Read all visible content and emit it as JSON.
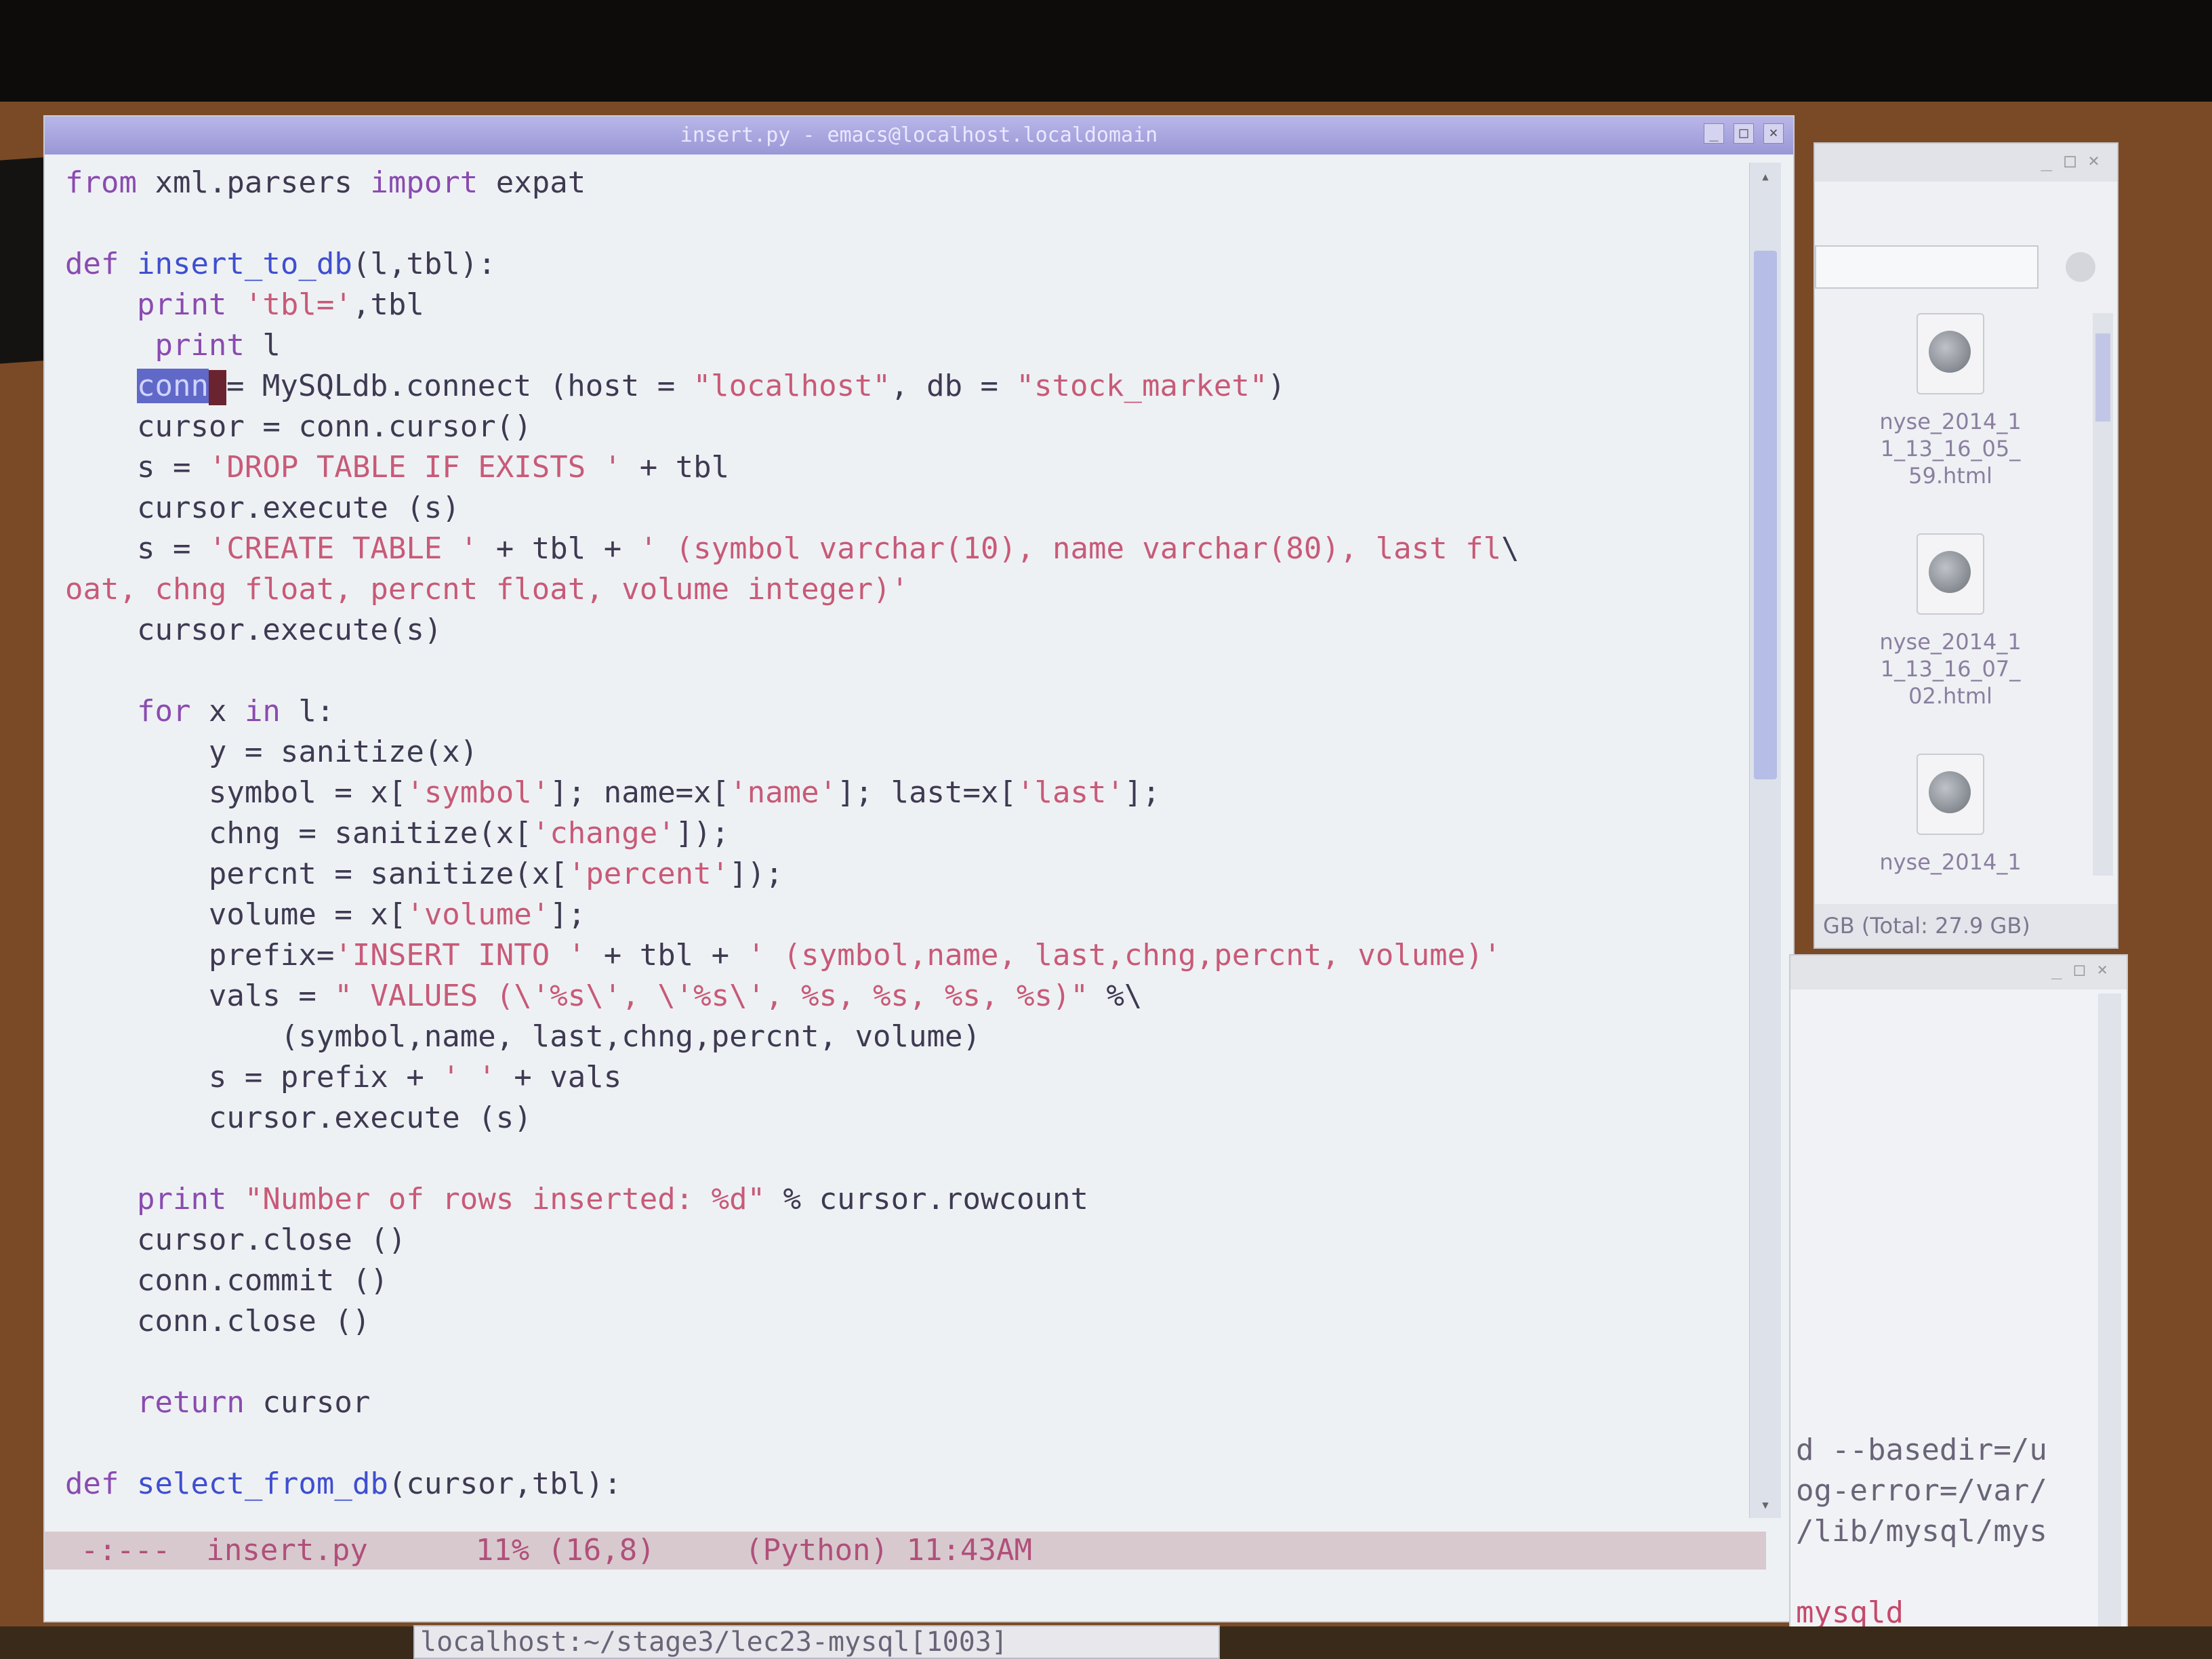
{
  "editor": {
    "title": "insert.py - emacs@localhost.localdomain",
    "lines": [
      {
        "parts": [
          {
            "t": "from",
            "c": "kw"
          },
          {
            "t": " xml.parsers "
          },
          {
            "t": "import",
            "c": "kw"
          },
          {
            "t": " expat"
          }
        ]
      },
      {
        "parts": [
          {
            "t": ""
          }
        ]
      },
      {
        "parts": [
          {
            "t": "def ",
            "c": "kw"
          },
          {
            "t": "insert_to_db",
            "c": "fn"
          },
          {
            "t": "(l,tbl):"
          }
        ]
      },
      {
        "parts": [
          {
            "t": "    "
          },
          {
            "t": "print",
            "c": "kw"
          },
          {
            "t": " "
          },
          {
            "t": "'tbl='",
            "c": "str"
          },
          {
            "t": ",tbl"
          }
        ]
      },
      {
        "parts": [
          {
            "t": "     "
          },
          {
            "t": "print",
            "c": "kw"
          },
          {
            "t": " l"
          }
        ]
      },
      {
        "parts": [
          {
            "t": "    "
          },
          {
            "t": "conn",
            "c": "sel"
          },
          {
            "t": "",
            "c": "caret"
          },
          {
            "t": "= MySQLdb.connect (host = "
          },
          {
            "t": "\"localhost\"",
            "c": "str"
          },
          {
            "t": ", db = "
          },
          {
            "t": "\"stock_market\"",
            "c": "str"
          },
          {
            "t": ")"
          }
        ]
      },
      {
        "parts": [
          {
            "t": "    cursor = conn.cursor()"
          }
        ]
      },
      {
        "parts": [
          {
            "t": "    s = "
          },
          {
            "t": "'DROP TABLE IF EXISTS '",
            "c": "str"
          },
          {
            "t": " + tbl"
          }
        ]
      },
      {
        "parts": [
          {
            "t": "    cursor.execute (s)"
          }
        ]
      },
      {
        "parts": [
          {
            "t": "    s = "
          },
          {
            "t": "'CREATE TABLE '",
            "c": "str"
          },
          {
            "t": " + tbl + "
          },
          {
            "t": "' (symbol varchar(10), name varchar(80), last fl",
            "c": "str"
          },
          {
            "t": "\\"
          }
        ]
      },
      {
        "parts": [
          {
            "t": "oat, chng float, percnt float, volume integer)'",
            "c": "str"
          }
        ]
      },
      {
        "parts": [
          {
            "t": "    cursor.execute(s)"
          }
        ]
      },
      {
        "parts": [
          {
            "t": ""
          }
        ]
      },
      {
        "parts": [
          {
            "t": "    "
          },
          {
            "t": "for",
            "c": "kw"
          },
          {
            "t": " x "
          },
          {
            "t": "in",
            "c": "kw"
          },
          {
            "t": " l:"
          }
        ]
      },
      {
        "parts": [
          {
            "t": "        y = sanitize(x)"
          }
        ]
      },
      {
        "parts": [
          {
            "t": "        symbol = x["
          },
          {
            "t": "'symbol'",
            "c": "str"
          },
          {
            "t": "]; name=x["
          },
          {
            "t": "'name'",
            "c": "str"
          },
          {
            "t": "]; last=x["
          },
          {
            "t": "'last'",
            "c": "str"
          },
          {
            "t": "];"
          }
        ]
      },
      {
        "parts": [
          {
            "t": "        chng = sanitize(x["
          },
          {
            "t": "'change'",
            "c": "str"
          },
          {
            "t": "]);"
          }
        ]
      },
      {
        "parts": [
          {
            "t": "        percnt = sanitize(x["
          },
          {
            "t": "'percent'",
            "c": "str"
          },
          {
            "t": "]);"
          }
        ]
      },
      {
        "parts": [
          {
            "t": "        volume = x["
          },
          {
            "t": "'volume'",
            "c": "str"
          },
          {
            "t": "];"
          }
        ]
      },
      {
        "parts": [
          {
            "t": "        prefix="
          },
          {
            "t": "'INSERT INTO '",
            "c": "str"
          },
          {
            "t": " + tbl + "
          },
          {
            "t": "' (symbol,name, last,chng,percnt, volume)'",
            "c": "str"
          }
        ]
      },
      {
        "parts": [
          {
            "t": "        vals = "
          },
          {
            "t": "\" VALUES (\\'%s\\', \\'%s\\', %s, %s, %s, %s)\"",
            "c": "str"
          },
          {
            "t": " %\\"
          }
        ]
      },
      {
        "parts": [
          {
            "t": "            (symbol,name, last,chng,percnt, volume)"
          }
        ]
      },
      {
        "parts": [
          {
            "t": "        s = prefix + "
          },
          {
            "t": "' '",
            "c": "str"
          },
          {
            "t": " + vals"
          }
        ]
      },
      {
        "parts": [
          {
            "t": "        cursor.execute (s)"
          }
        ]
      },
      {
        "parts": [
          {
            "t": ""
          }
        ]
      },
      {
        "parts": [
          {
            "t": "    "
          },
          {
            "t": "print",
            "c": "kw"
          },
          {
            "t": " "
          },
          {
            "t": "\"Number of rows inserted: %d\"",
            "c": "str"
          },
          {
            "t": " % cursor.rowcount"
          }
        ]
      },
      {
        "parts": [
          {
            "t": "    cursor.close ()"
          }
        ]
      },
      {
        "parts": [
          {
            "t": "    conn.commit ()"
          }
        ]
      },
      {
        "parts": [
          {
            "t": "    conn.close ()"
          }
        ]
      },
      {
        "parts": [
          {
            "t": ""
          }
        ]
      },
      {
        "parts": [
          {
            "t": "    "
          },
          {
            "t": "return",
            "c": "kw"
          },
          {
            "t": " cursor"
          }
        ]
      },
      {
        "parts": [
          {
            "t": ""
          }
        ]
      },
      {
        "parts": [
          {
            "t": "def ",
            "c": "kw"
          },
          {
            "t": "select_from_db",
            "c": "fn"
          },
          {
            "t": "(cursor,tbl):"
          }
        ]
      }
    ],
    "modeline": "  -:---  insert.py      11% (16,8)     (Python) 11:43AM",
    "scroll": {
      "up": "▴",
      "down": "▾"
    }
  },
  "filebrowser": {
    "files": [
      "nyse_2014_1\n1_13_16_05_\n59.html",
      "nyse_2014_1\n1_13_16_07_\n02.html",
      "nyse_2014_1"
    ],
    "status": "GB (Total: 27.9 GB)"
  },
  "terminal": {
    "lines": [
      {
        "t": "d --basedir=/u",
        "red": false
      },
      {
        "t": "og-error=/var/",
        "red": false
      },
      {
        "t": "/lib/mysql/mys",
        "red": false
      },
      {
        "t": "",
        "red": false
      },
      {
        "t": "mysqld",
        "red": true
      }
    ]
  },
  "taskbar": {
    "text": "localhost:~/stage3/lec23-mysql[1003]"
  },
  "colors": {
    "keyword": "#8a4bb0",
    "function": "#3f4fd0",
    "string": "#c85a78",
    "text": "#3e3a52",
    "titlebar": "#9a97d6"
  },
  "icons": [
    "globe-file-icon",
    "search-icon",
    "window-close-icon",
    "window-maximize-icon",
    "window-minimize-icon"
  ]
}
